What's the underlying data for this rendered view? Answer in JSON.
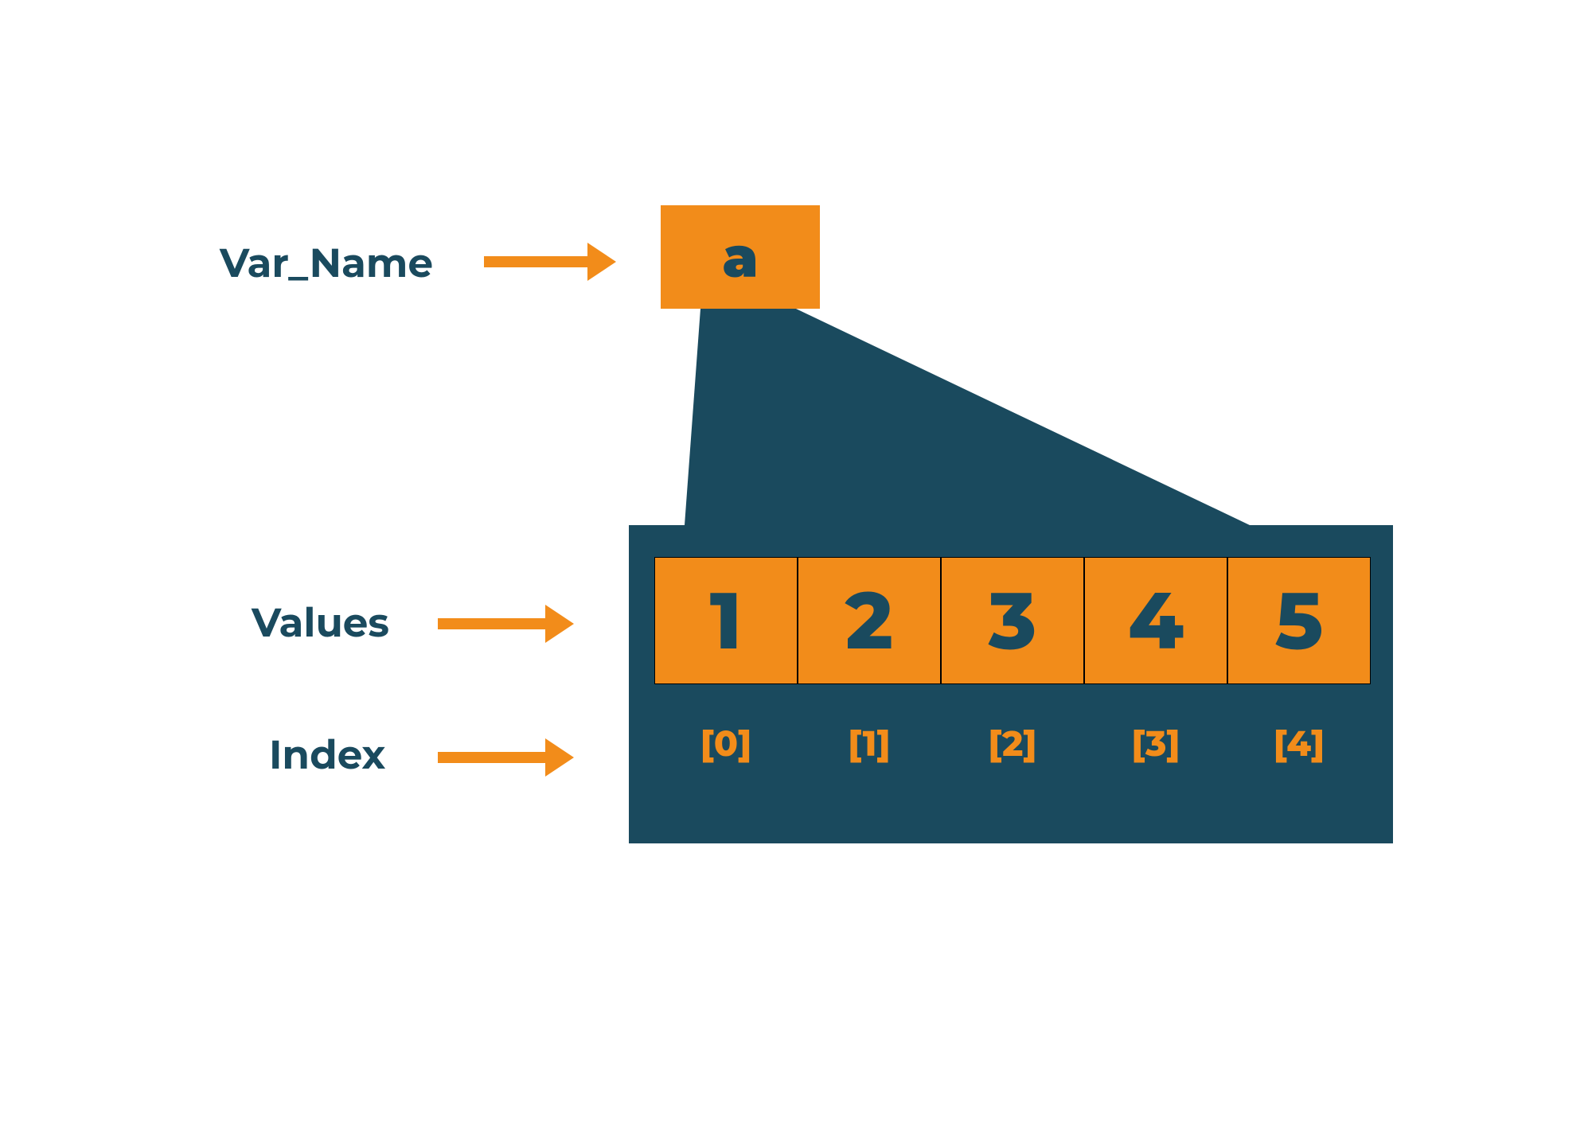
{
  "labels": {
    "varName": "Var_Name",
    "values": "Values",
    "index": "Index"
  },
  "varBox": {
    "name": "a"
  },
  "array": {
    "values": [
      "1",
      "2",
      "3",
      "4",
      "5"
    ],
    "indices": [
      "[0]",
      "[1]",
      "[2]",
      "[3]",
      "[4]"
    ]
  },
  "colors": {
    "darkBlue": "#1a4a5e",
    "orange": "#f28c1a"
  }
}
